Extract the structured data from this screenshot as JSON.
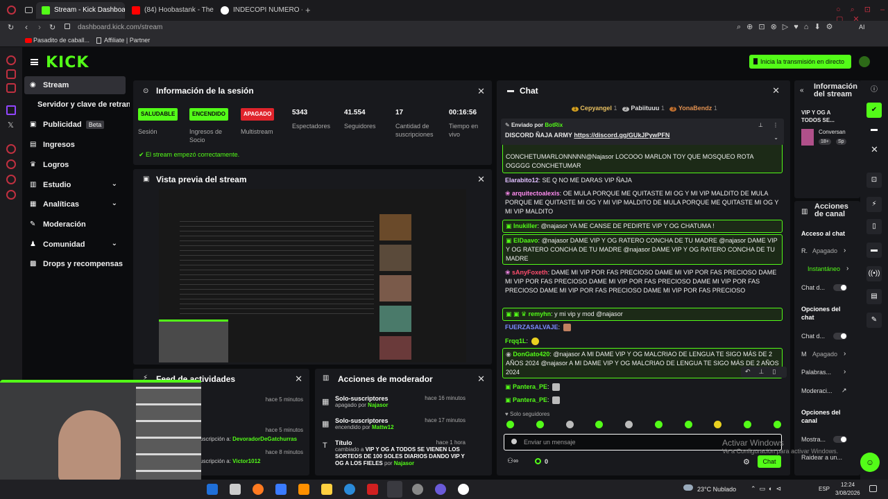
{
  "browser": {
    "tabs": [
      {
        "label": "Stream - Kick Dashboard",
        "color": "#53fc18"
      },
      {
        "label": "(84) Hoobastank - The",
        "color": "#ff0000"
      },
      {
        "label": "INDECOPI NUMERO - Busc",
        "color": "#4285f4"
      }
    ],
    "url": "dashboard.kick.com/stream",
    "bookmarks": [
      "Pasadito de caball...",
      "Affiliate | Partner"
    ]
  },
  "kick": {
    "logo": "KICK",
    "go_live_label": "Inicia la transmisión en directo"
  },
  "nav": [
    {
      "label": "Stream",
      "icon": "stream-icon"
    },
    {
      "label": "Servidor y clave de retransn",
      "icon": ""
    },
    {
      "label": "Publicidad",
      "badge": "Beta",
      "icon": "ads-icon"
    },
    {
      "label": "Ingresos",
      "icon": "revenue-icon"
    },
    {
      "label": "Logros",
      "icon": "trophy-icon"
    },
    {
      "label": "Estudio",
      "icon": "studio-icon"
    },
    {
      "label": "Analíticas",
      "icon": "analytics-icon"
    },
    {
      "label": "Moderación",
      "icon": "moderation-icon"
    },
    {
      "label": "Comunidad",
      "icon": "community-icon"
    },
    {
      "label": "Drops y recompensas",
      "icon": "drops-icon"
    }
  ],
  "session": {
    "title": "Información de la sesión",
    "status_ok": "El stream empezó correctamente.",
    "stats": [
      {
        "badge": "SALUDABLE",
        "label": "Sesión"
      },
      {
        "badge": "ENCENDIDO",
        "label": "Ingresos de Socio"
      },
      {
        "badge": "APAGADO",
        "label": "Multistream"
      },
      {
        "value": "5343",
        "label": "Espectadores"
      },
      {
        "value": "41.554",
        "label": "Seguidores"
      },
      {
        "value": "17",
        "label": "Cantidad de suscripciones"
      },
      {
        "value": "00:16:56",
        "label": "Tiempo en vivo"
      }
    ]
  },
  "preview": {
    "title": "Vista previa del stream"
  },
  "activity": {
    "title": "Feed de actividades",
    "items": [
      {
        "time": "hace 5 minutos",
        "text": ""
      },
      {
        "time": "hace 5 minutos",
        "text": "uscripción a:",
        "user": "DevoradorDeGatchurras"
      },
      {
        "time": "hace 8 minutos",
        "text": "uscripción a:",
        "user": "Victor1012"
      }
    ]
  },
  "mod_actions": {
    "title": "Acciones de moderador",
    "items": [
      {
        "title": "Solo-suscriptores",
        "sub": "apagado por",
        "user": "Najasor",
        "time": "hace 16 minutos"
      },
      {
        "title": "Solo-suscriptores",
        "sub": "encendido por",
        "user": "Mattw12",
        "time": "hace 17 minutos"
      },
      {
        "title": "Título",
        "sub": "cambiado a",
        "bold": "VIP Y OG A TODOS SE VIENEN LOS SORTEOS DE 100 SOLES DIARIOS DANDO VIP Y OG A LOS FIELES",
        "tail": "por",
        "user": "Najasor",
        "time": "hace 1 hora"
      }
    ]
  },
  "chat": {
    "title": "Chat",
    "gifters": [
      {
        "rank": "1",
        "name": "Cepyangel",
        "count": "1"
      },
      {
        "rank": "2",
        "name": "Pabiituuu",
        "count": "1"
      },
      {
        "rank": "3",
        "name": "YonaBendz",
        "count": "1"
      }
    ],
    "pinned_by": "Enviado por",
    "pinned_user": "BotRix",
    "pinned_text": "DISCORD ÑAJA ARMY",
    "pinned_link": "https://discord.gg/GUkJPywPFN",
    "messages": [
      {
        "user": "",
        "text": "CONCHETUMARLONNNNN@Najasor LOCOOO MARLON TOY QUE MOSQUEO ROTA OGGGG CONCHETUMAR",
        "color": "#fff",
        "hl": true
      },
      {
        "user": "Elarabito12",
        "text": "SE Q NO ME DARAS VIP ÑAJA",
        "color": "#e0c0ff"
      },
      {
        "user": "arquitectoalexis",
        "text": "OE MULA PORQUE ME QUITASTE MI OG Y MI VIP MALDITO DE MULA PORQUE ME QUITASTE MI OG Y MI VIP MALDITO DE MULA PORQUE ME QUITASTE MI OG Y MI VIP MALDITO",
        "color": "#ff8cf0"
      },
      {
        "user": "Inukiller",
        "text": "@najasor YA ME CANSE DE PEDIRTE VIP Y OG CHATUMA !",
        "color": "#53fc18",
        "hl": true
      },
      {
        "user": "ElDaavo",
        "text": "@najasor DAME VIP Y OG RATERO CONCHA DE TU MADRE @najasor DAME VIP Y OG RATERO CONCHA DE TU MADRE @najasor DAME VIP Y OG RATERO CONCHA DE TU MADRE",
        "color": "#53fc18",
        "hl": true
      },
      {
        "user": "sAnyFoxeth",
        "text": "DAME MI VIP POR FAS PRECIOSO DAME MI VIP POR FAS PRECIOSO DAME MI VIP POR FAS PRECIOSO DAME MI VIP POR FAS PRECIOSO DAME MI VIP POR FAS PRECIOSO DAME MI VIP POR FAS PRECIOSO DAME MI VIP POR FAS PRECIOSO",
        "color": "#ff4d6d"
      },
      {
        "user": "remyhn",
        "text": "y mi vip y mod @najasor",
        "color": "#53fc18",
        "hl": true
      },
      {
        "user": "FUERZASALVAJE",
        "text": "",
        "color": "#7c8cff"
      },
      {
        "user": "Frqq1L",
        "text": "",
        "color": "#53fc18"
      },
      {
        "user": "DonGato420",
        "text": "@najasor A MI DAME VIP Y OG MALCRIAO DE LENGUA TE SIGO MÁS DE 2 AÑOS 2024 @najasor A MI DAME VIP Y OG MALCRIAO DE LENGUA TE SIGO MÁS DE 2 AÑOS 2024",
        "color": "#53fc18",
        "hl": true
      },
      {
        "user": "Pantera_PE",
        "text": "",
        "color": "#53fc18"
      },
      {
        "user": "Pantera_PE",
        "text": "",
        "color": "#53fc18"
      }
    ],
    "followers_only": "Solo seguidores",
    "input_placeholder": "Enviar un mensaje",
    "points": "0",
    "send_label": "Chat",
    "watermark_1": "Activar Windows",
    "watermark_2": "Ve a Configuración para activar Windows."
  },
  "stream_info": {
    "title": "Información del stream",
    "stream_title": "VIP Y OG A TODOS SE...",
    "category": "Conversan",
    "tags": [
      "18+",
      "Sp"
    ]
  },
  "channel_actions": {
    "title": "Acciones de canal",
    "chat_access": "Acceso al chat",
    "rows": [
      {
        "label": "R.",
        "value": "Apagado"
      },
      {
        "label": "",
        "value": "Instantáneo"
      },
      {
        "label": "Chat d...",
        "value": ""
      }
    ],
    "chat_options": "Opciones del chat",
    "rows2": [
      {
        "label": "Chat d...",
        "value": ""
      },
      {
        "label": "M",
        "value": "Apagado"
      },
      {
        "label": "Palabras...",
        "value": ""
      },
      {
        "label": "Moderaci...",
        "value": ""
      }
    ],
    "channel_options": "Opciones del canal",
    "rows3": [
      {
        "label": "Mostra...",
        "value": ""
      },
      {
        "label": "Raidear a un...",
        "value": ""
      }
    ]
  },
  "taskbar": {
    "weather": "23°C Nublado",
    "lang": "ESP",
    "time": "12:24",
    "date": "3/08/2026"
  },
  "colors": {
    "accent": "#53fc18",
    "bg": "#0b0c0e",
    "panel": "#18191d"
  }
}
